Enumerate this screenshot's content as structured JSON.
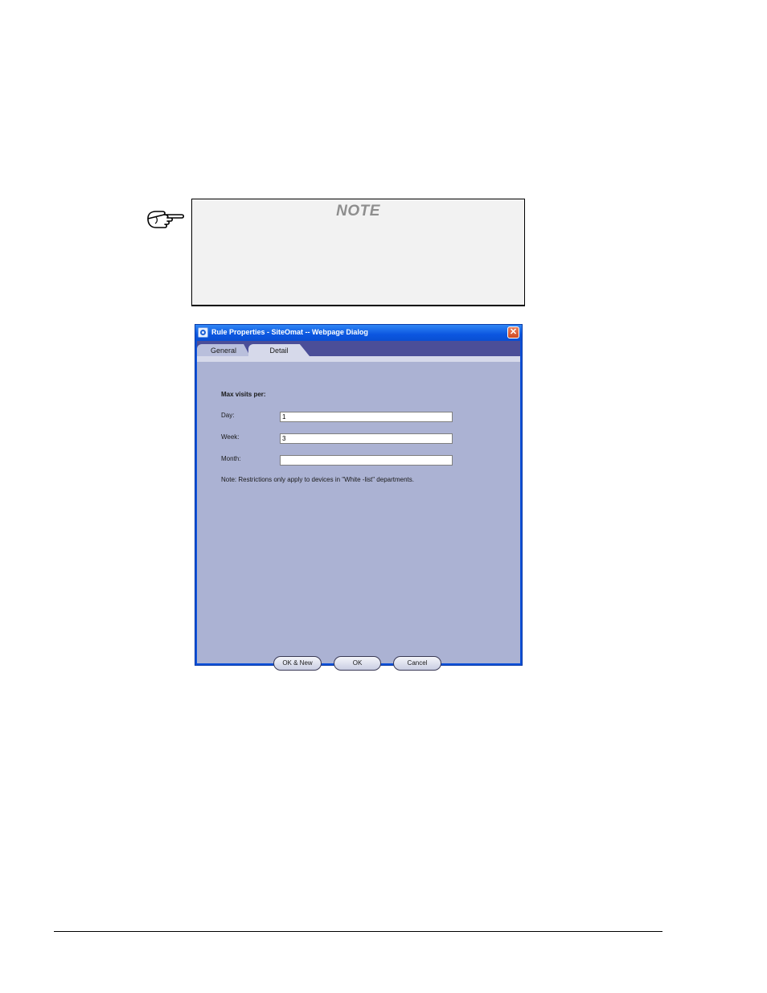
{
  "note": {
    "title": "NOTE",
    "icon": "pointing-hand-icon"
  },
  "dialog": {
    "title": "Rule Properties - SiteOmat -- Webpage Dialog",
    "close_label": "✕",
    "tabs": [
      {
        "label": "General",
        "active": false
      },
      {
        "label": "Detail",
        "active": true
      }
    ],
    "heading": "Max visits per:",
    "fields": {
      "day": {
        "label": "Day:",
        "value": "1"
      },
      "week": {
        "label": "Week:",
        "value": "3"
      },
      "month": {
        "label": "Month:",
        "value": ""
      }
    },
    "note_text": "Note: Restrictions only apply to devices in \"White -list\" departments.",
    "buttons": {
      "ok_new": "OK & New",
      "ok": "OK",
      "cancel": "Cancel"
    }
  },
  "colors": {
    "dialog_background": "#abb2d3",
    "tabstrip": "#4b4e98",
    "titlebar": "#0b56e0",
    "note_background": "#f2f2f2"
  }
}
